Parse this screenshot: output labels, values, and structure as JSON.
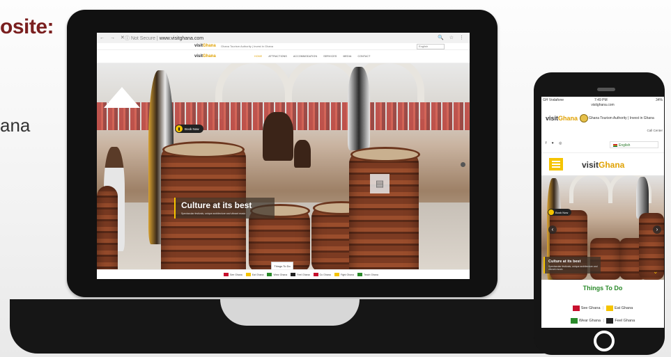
{
  "slide": {
    "title_fragment": "osite:",
    "text_fragment": "ana"
  },
  "browser": {
    "nav_icons": "← → ✕",
    "url_prefix": "ⓘ Not Secure |",
    "url": "www.visitghana.com",
    "tools": "🔍 ☆ ⋮"
  },
  "site": {
    "logo_visit": "visit",
    "logo_ghana": "Ghana",
    "top_text": "Ghana Tourism Authority | Invest in Ghana",
    "language": "English",
    "nav_items": [
      "HOME",
      "ATTRACTIONS",
      "ACCOMMODATION",
      "SERVICES",
      "MEDIA",
      "CONTACT"
    ],
    "book_now": "Book Now",
    "caption_title": "Culture at its best",
    "caption_sub": "Spectacular festivals, unique architecture and vibrant music",
    "things_tab": "Things To Do",
    "footer_items": [
      "See Ghana",
      "Eat Ghana",
      "Wear Ghana",
      "Feel Ghana",
      "Go Ghana",
      "Fight Ghana",
      "Teach Ghana"
    ]
  },
  "phone": {
    "carrier": "GH Vodafone",
    "time": "7:49 PM",
    "battery": "34%",
    "url": "visitghana.com",
    "logo_visit": "visit",
    "logo_ghana": "Ghana",
    "header_text": "Ghana Tourism Authority | Invest in Ghana",
    "call_center": "Call Center",
    "social": "f ♥ ◎",
    "language": "English",
    "book_now": "Book Now",
    "caption_title": "Culture at its best",
    "caption_sub": "Spectacular festivals, unique architecture and vibrant music",
    "things_to_do": "Things To Do",
    "links_row1_a": "See Ghana",
    "links_row1_b": "Eat Ghana",
    "links_row2_a": "Wear Ghana",
    "links_row2_b": "Feel Ghana"
  },
  "colors": {
    "accent_yellow": "#f5c400",
    "ghana_gold": "#e0a100",
    "title_maroon": "#7a1f1f",
    "green": "#2a8a2a"
  }
}
